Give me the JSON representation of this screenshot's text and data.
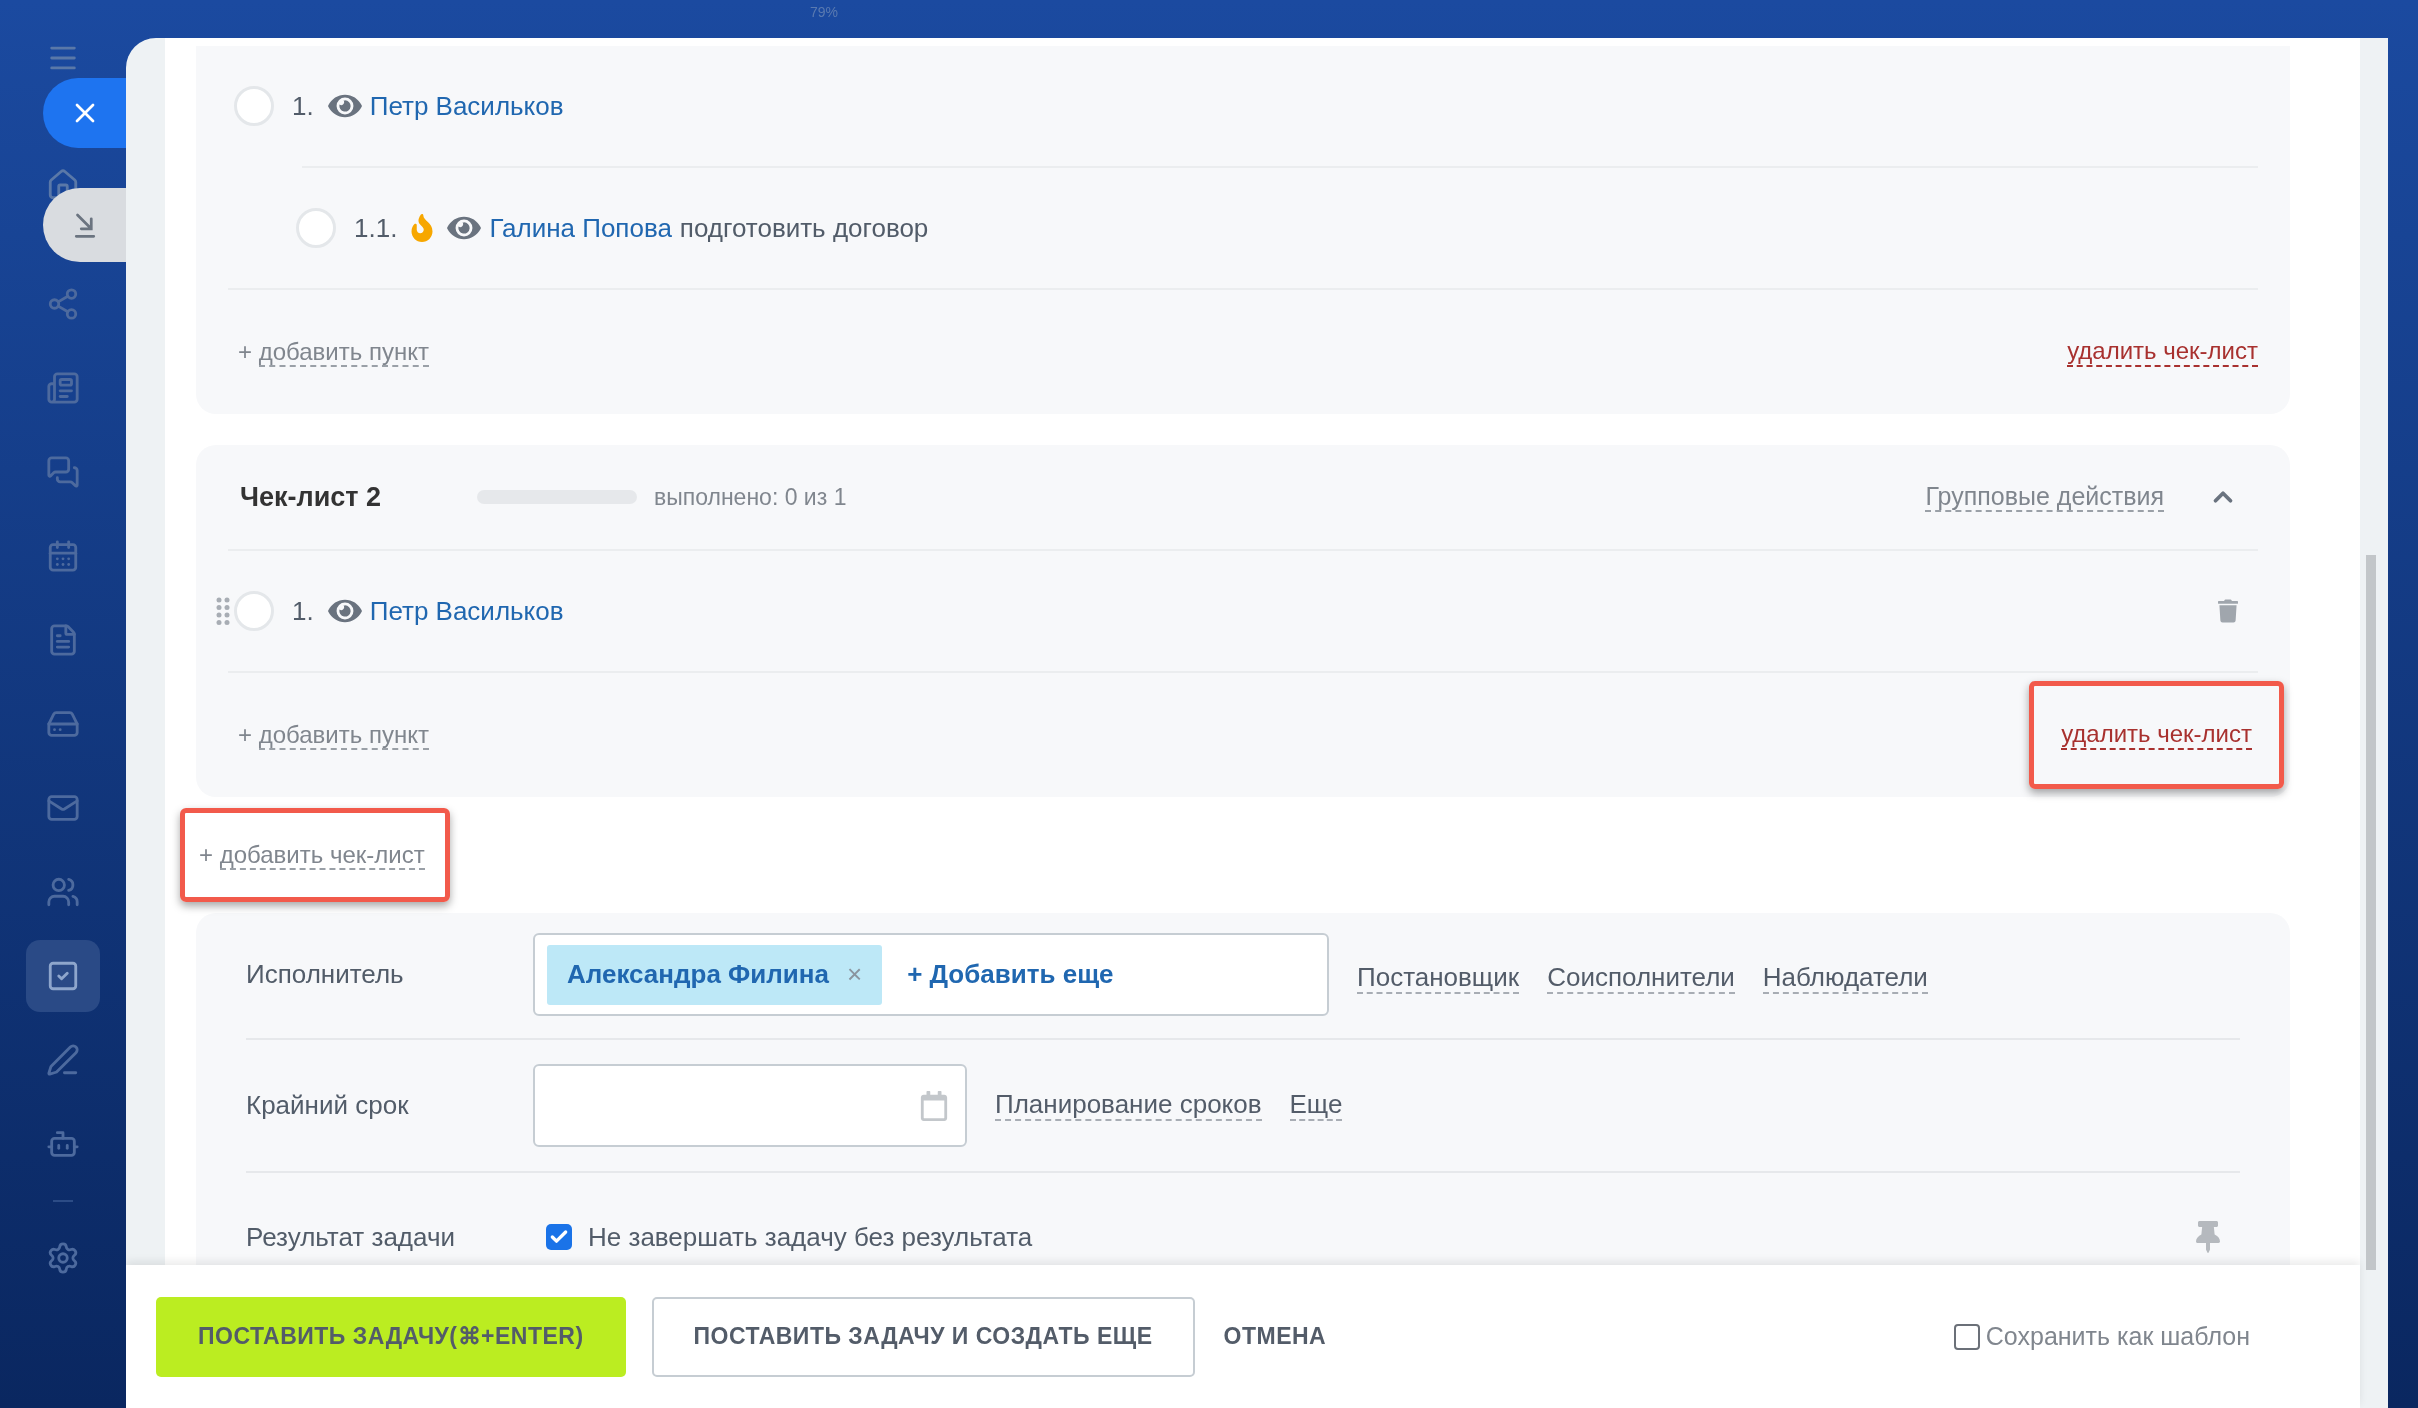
{
  "background": {
    "zoom_label": "79%"
  },
  "sidebar": {
    "items": [
      {
        "selected": false
      },
      {
        "selected": false
      },
      {
        "selected": false
      },
      {
        "selected": false
      },
      {
        "selected": false
      },
      {
        "selected": false
      },
      {
        "selected": false
      },
      {
        "selected": false
      },
      {
        "selected": true
      },
      {
        "selected": false
      },
      {
        "selected": false
      },
      {
        "selected": false
      }
    ]
  },
  "checklists": [
    {
      "items": [
        {
          "number": "1.",
          "checked": false,
          "important": false,
          "hovered": false,
          "person": "Петр Васильков",
          "children": [
            {
              "number": "1.1.",
              "checked": false,
              "important": true,
              "hovered": false,
              "person": "Галина Попова",
              "text": "подготовить договор"
            }
          ]
        }
      ],
      "add_item": {
        "prefix": "+",
        "label": "добавить пункт"
      },
      "delete": {
        "label": "удалить чек-лист",
        "highlighted": false
      }
    },
    {
      "title": "Чек-лист 2",
      "progress": {
        "level": 0,
        "text": "выполнено: 0 из 1"
      },
      "group_actions": "Групповые действия",
      "expanded": true,
      "items": [
        {
          "number": "1.",
          "checked": false,
          "important": false,
          "hovered": true,
          "person": "Петр Васильков"
        }
      ],
      "add_item": {
        "prefix": "+",
        "label": "добавить пункт"
      },
      "delete": {
        "label": "удалить чек-лист",
        "highlighted": true
      }
    }
  ],
  "add_checklist": {
    "prefix": "+",
    "label": "добавить чек-лист",
    "highlighted": true
  },
  "form": {
    "rows": [
      {
        "kind": "people",
        "label": "Исполнитель",
        "chips": [
          {
            "name": "Александра Филина",
            "remove": "×"
          }
        ],
        "add_more": "+ Добавить еще",
        "links": [
          "Постановщик",
          "Соисполнители",
          "Наблюдатели"
        ]
      },
      {
        "kind": "date",
        "label": "Крайний срок",
        "links": [
          "Планирование сроков",
          "Еще"
        ]
      },
      {
        "kind": "checkbox",
        "label": "Результат задачи",
        "checked": true,
        "text": "Не завершать задачу без результата"
      }
    ]
  },
  "footer": {
    "buttons": [
      {
        "kind": "primary",
        "label": "ПОСТАВИТЬ ЗАДАЧУ(⌘+ENTER)"
      },
      {
        "kind": "secondary",
        "label": "ПОСТАВИТЬ ЗАДАЧУ И СОЗДАТЬ ЕЩЕ"
      },
      {
        "kind": "link",
        "label": "ОТМЕНА"
      }
    ],
    "template": {
      "checked": false,
      "label": "Сохранить как шаблон"
    }
  }
}
